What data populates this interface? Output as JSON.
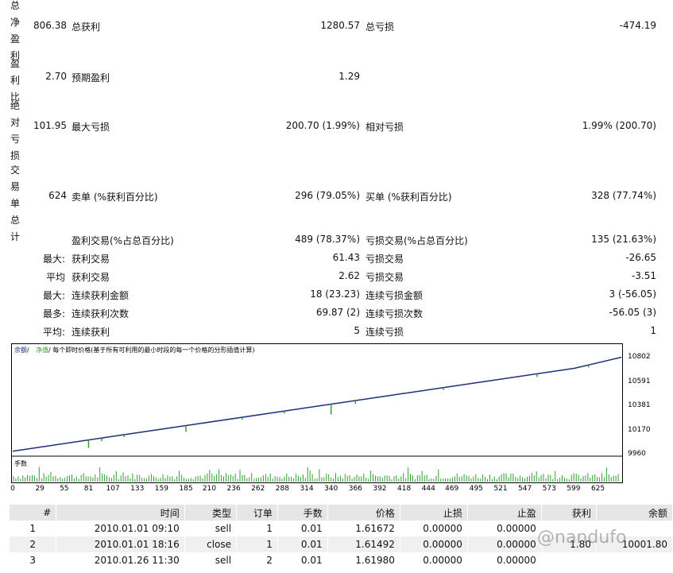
{
  "summary": {
    "net_profit": {
      "side": "总净盈利",
      "value": "806.38",
      "l1": "总获利",
      "v1": "1280.57",
      "l2": "总亏损",
      "v2": "-474.19"
    },
    "profit_factor": {
      "side": "盈利比",
      "value": "2.70",
      "l1": "预期盈利",
      "v1": "1.29"
    },
    "drawdown": {
      "side": "绝对亏损",
      "value": "101.95",
      "l1": "最大亏损",
      "v1": "200.70 (1.99%)",
      "l2": "相对亏损",
      "v2": "1.99% (200.70)"
    },
    "trades": {
      "side": "交易单总计",
      "value": "624",
      "l1": "卖单 (%获利百分比)",
      "v1": "296 (79.05%)",
      "l2": "买单 (%获利百分比)",
      "v2": "328 (77.74%)"
    },
    "rows": [
      {
        "prefix": "",
        "l1": "盈利交易(%占总百分比)",
        "v1": "489 (78.37%)",
        "l2": "亏损交易(%占总百分比)",
        "v2": "135 (21.63%)"
      },
      {
        "prefix": "最大:",
        "l1": "获利交易",
        "v1": "61.43",
        "l2": "亏损交易",
        "v2": "-26.65"
      },
      {
        "prefix": "平均",
        "l1": "获利交易",
        "v1": "2.62",
        "l2": "亏损交易",
        "v2": "-3.51"
      },
      {
        "prefix": "最大:",
        "l1": "连续获利金额",
        "v1": "18 (23.23)",
        "l2": "连续亏损金额",
        "v2": "3 (-56.05)"
      },
      {
        "prefix": "最多:",
        "l1": "连续获利次数",
        "v1": "69.87 (2)",
        "l2": "连续亏损次数",
        "v2": "-56.05 (3)"
      },
      {
        "prefix": "平均:",
        "l1": "连续获利",
        "v1": "5",
        "l2": "连续亏损",
        "v2": "1"
      }
    ]
  },
  "chart": {
    "legend_balance": "余额",
    "legend_sep1": " / ",
    "legend_equity": "净值",
    "legend_rest": " / 每个即时价格(基于所有可利用的最小时段的每一个价格的分形插值计算)",
    "volume_label": "手数",
    "colors": {
      "balance": "#1f2f7a",
      "equity": "#2ea02e",
      "volume": "#2ea02e"
    }
  },
  "chart_data": {
    "type": "line",
    "x_ticks": [
      "0",
      "29",
      "55",
      "81",
      "107",
      "133",
      "159",
      "185",
      "210",
      "236",
      "262",
      "288",
      "314",
      "340",
      "366",
      "392",
      "418",
      "444",
      "469",
      "495",
      "521",
      "547",
      "573",
      "599",
      "625"
    ],
    "y_ticks": [
      "10802",
      "10591",
      "10381",
      "10170",
      "9960"
    ],
    "ylim": [
      9960,
      10830
    ],
    "xlim": [
      0,
      650
    ],
    "series": [
      {
        "name": "余额",
        "x": [
          0,
          100,
          200,
          300,
          400,
          500,
          600,
          650
        ],
        "y": [
          9990,
          10110,
          10230,
          10350,
          10470,
          10590,
          10710,
          10806
        ]
      }
    ]
  },
  "table": {
    "headers": [
      "#",
      "时间",
      "类型",
      "订单",
      "手数",
      "价格",
      "止损",
      "止盈",
      "获利",
      "余额"
    ],
    "rows": [
      [
        "1",
        "2010.01.01 09:10",
        "sell",
        "1",
        "0.01",
        "1.61672",
        "0.00000",
        "0.00000",
        "",
        ""
      ],
      [
        "2",
        "2010.01.01 18:16",
        "close",
        "1",
        "0.01",
        "1.61492",
        "0.00000",
        "0.00000",
        "1.80",
        "10001.80"
      ],
      [
        "3",
        "2010.01.26 11:30",
        "sell",
        "2",
        "0.01",
        "1.61980",
        "0.00000",
        "0.00000",
        "",
        ""
      ]
    ]
  },
  "watermark": "@nandufo"
}
